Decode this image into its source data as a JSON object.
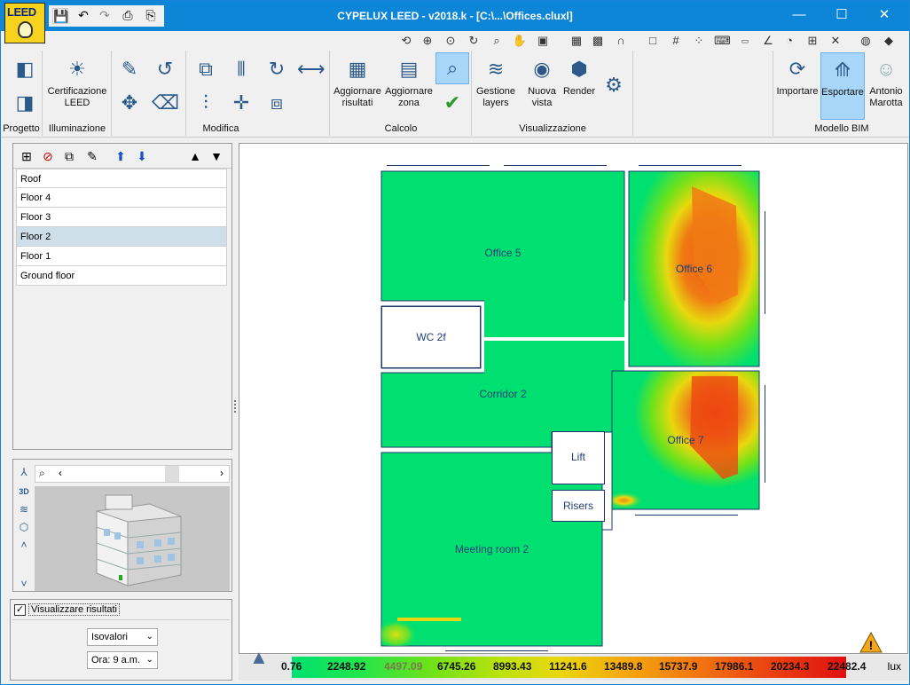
{
  "app": {
    "logo_text": "LEED",
    "title": "CYPELUX LEED - v2018.k - [C:\\...\\Offices.cluxl]"
  },
  "ribbon": {
    "buttons": {
      "certificazione": "Certificazione\nLEED",
      "aggiornare_risultati": "Aggiornare\nrisultati",
      "aggiornare_zona": "Aggiornare\nzona",
      "gestione_layers": "Gestione\nlayers",
      "nuova_vista": "Nuova\nvista",
      "render": "Render",
      "importare": "Importare",
      "esportare": "Esportare",
      "user": "Antonio\nMarotta"
    },
    "groups": {
      "progetto": "Progetto",
      "illuminazione": "Illuminazione",
      "modifica": "Modifica",
      "calcolo": "Calcolo",
      "visualizzazione": "Visualizzazione",
      "modello_bim": "Modello BIM"
    }
  },
  "floors": [
    "Roof",
    "Floor 4",
    "Floor 3",
    "Floor 2",
    "Floor 1",
    "Ground floor"
  ],
  "selected_floor": "Floor 2",
  "results": {
    "checkbox_label": "Visualizzare risultati",
    "mode_value": "Isovalori",
    "time_value": "Ora: 9 a.m."
  },
  "rooms": {
    "office5": "Office 5",
    "office6": "Office 6",
    "wc2f": "WC 2f",
    "corridor2": "Corridor 2",
    "office7": "Office 7",
    "lift": "Lift",
    "risers": "Risers",
    "meeting2": "Meeting room 2"
  },
  "legend": {
    "values": [
      "0.76",
      "2248.92",
      "4497.09",
      "6745.26",
      "8993.43",
      "11241.6",
      "13489.8",
      "15737.9",
      "17986.1",
      "20234.3",
      "22482.4"
    ],
    "unit": "lux"
  },
  "colors": {
    "titlebar": "#0e86d8",
    "low_lux": "#00e070",
    "high_lux": "#e01010",
    "selected_row": "#cfdfe9"
  }
}
